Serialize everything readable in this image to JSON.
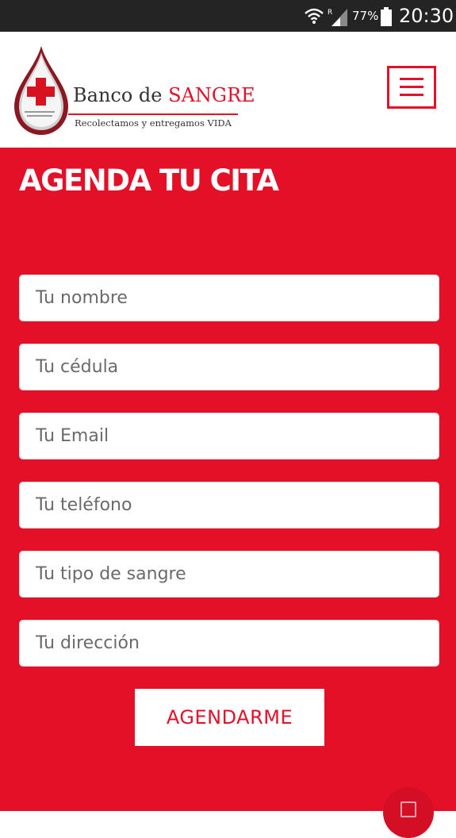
{
  "status_bar": {
    "battery_percent": "77%",
    "time": "20:30",
    "icons": [
      "wifi-icon",
      "signal-icon",
      "battery-icon"
    ]
  },
  "header": {
    "logo": {
      "title_prefix": "Banco de ",
      "title_accent": "SANGRE",
      "tagline": "Recolectamos y entregamos VIDA"
    },
    "menu_icon": "hamburger-menu-icon"
  },
  "form": {
    "title": "AGENDA TU CITA",
    "fields": {
      "name": {
        "placeholder": "Tu nombre"
      },
      "id_number": {
        "placeholder": "Tu cédula"
      },
      "email": {
        "placeholder": "Tu Email"
      },
      "phone": {
        "placeholder": "Tu teléfono"
      },
      "blood_type": {
        "placeholder": "Tu tipo de sangre"
      },
      "address": {
        "placeholder": "Tu dirección"
      }
    },
    "submit_label": "AGENDARME"
  },
  "colors": {
    "brand_red": "#e31028",
    "status_bar": "#242424",
    "white": "#ffffff"
  }
}
